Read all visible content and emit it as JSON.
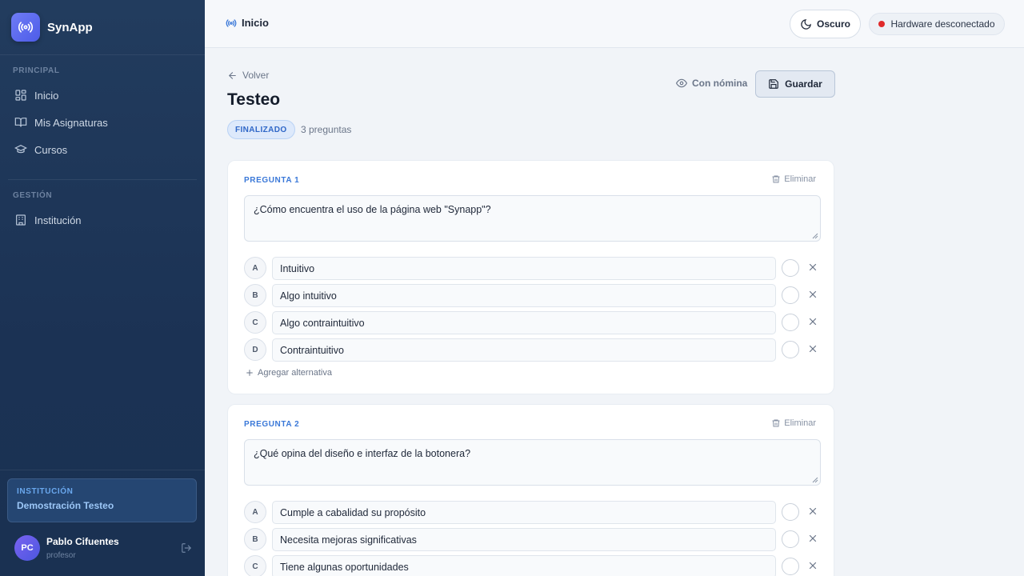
{
  "brand": {
    "name": "SynApp"
  },
  "sidebar": {
    "sections": [
      {
        "heading": "PRINCIPAL",
        "items": [
          {
            "label": "Inicio",
            "icon": "grid-icon"
          },
          {
            "label": "Mis Asignaturas",
            "icon": "book-icon"
          },
          {
            "label": "Cursos",
            "icon": "graduation-cap-icon"
          }
        ]
      },
      {
        "heading": "GESTIÓN",
        "items": [
          {
            "label": "Institución",
            "icon": "building-icon"
          }
        ]
      }
    ],
    "institution": {
      "label": "INSTITUCIÓN",
      "name": "Demostración Testeo"
    },
    "user": {
      "initials": "PC",
      "name": "Pablo Cifuentes",
      "role": "profesor"
    }
  },
  "topbar": {
    "breadcrumb": "Inicio",
    "theme_label": "Oscuro",
    "hardware_status": "Hardware desconectado",
    "hardware_status_color": "#e02a2a"
  },
  "page": {
    "back_label": "Volver",
    "title": "Testeo",
    "status": "FINALIZADO",
    "question_count": "3 preguntas",
    "nomina_label": "Con nómina",
    "save_label": "Guardar"
  },
  "questions": [
    {
      "label": "PREGUNTA 1",
      "delete_label": "Eliminar",
      "text": "¿Cómo encuentra el uso de la página web \"Synapp\"?",
      "alternatives": [
        {
          "letter": "A",
          "text": "Intuitivo"
        },
        {
          "letter": "B",
          "text": "Algo intuitivo"
        },
        {
          "letter": "C",
          "text": "Algo contraintuitivo"
        },
        {
          "letter": "D",
          "text": "Contraintuitivo"
        }
      ],
      "add_label": "Agregar alternativa"
    },
    {
      "label": "PREGUNTA 2",
      "delete_label": "Eliminar",
      "text": "¿Qué opina del diseño e interfaz de la botonera?",
      "alternatives": [
        {
          "letter": "A",
          "text": "Cumple a cabalidad su propósito"
        },
        {
          "letter": "B",
          "text": "Necesita mejoras significativas"
        },
        {
          "letter": "C",
          "text": "Tiene algunas oportunidades"
        }
      ]
    }
  ]
}
